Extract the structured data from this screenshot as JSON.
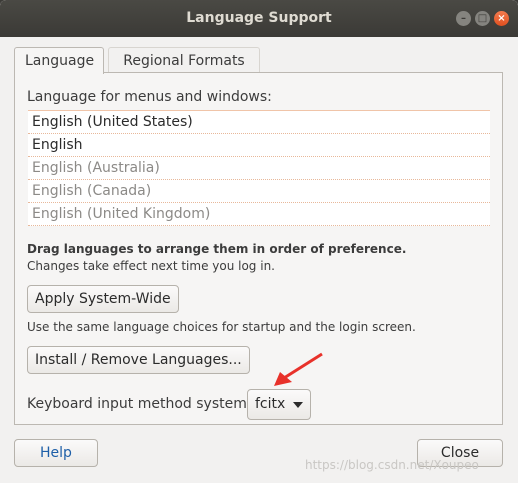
{
  "window": {
    "title": "Language Support"
  },
  "tabs": [
    {
      "label": "Language",
      "active": true
    },
    {
      "label": "Regional Formats",
      "active": false
    }
  ],
  "language": {
    "section_label": "Language for menus and windows:",
    "items": [
      {
        "label": "English (United States)",
        "enabled": true
      },
      {
        "label": "English",
        "enabled": true
      },
      {
        "label": "English (Australia)",
        "enabled": false
      },
      {
        "label": "English (Canada)",
        "enabled": false
      },
      {
        "label": "English (United Kingdom)",
        "enabled": false
      }
    ],
    "hint_bold": "Drag languages to arrange them in order of preference.",
    "hint": "Changes take effect next time you log in.",
    "apply_label": "Apply System-Wide",
    "apply_desc": "Use the same language choices for startup and the login screen.",
    "install_label": "Install / Remove Languages...",
    "kb_label": "Keyboard input method system:",
    "kb_value": "fcitx"
  },
  "footer": {
    "help_label": "Help",
    "close_label": "Close"
  },
  "watermark": "https://blog.csdn.net/Xoupeo",
  "colors": {
    "annotation_arrow": "#e8312a"
  }
}
